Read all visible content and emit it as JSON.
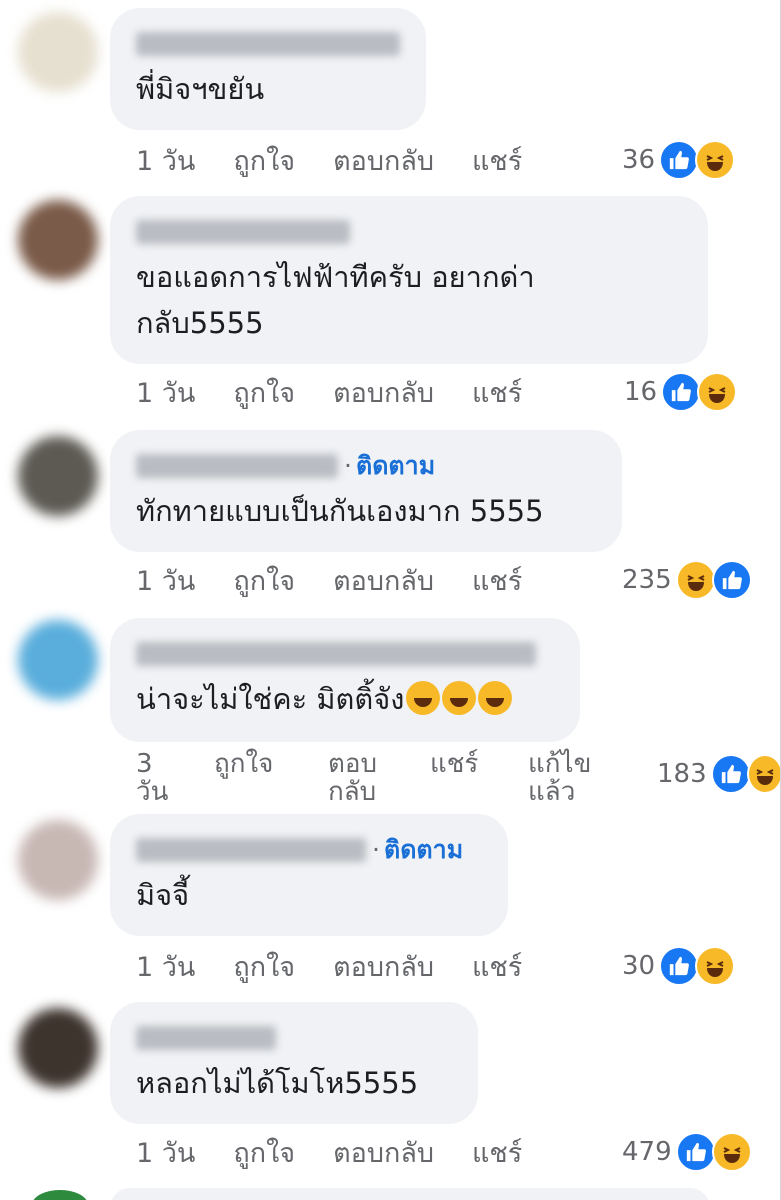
{
  "colors": {
    "bubble_bg": "#f0f2f5",
    "accent_blue": "#1a6fd6",
    "like_blue": "#1877f2",
    "haha_yellow": "#f7b928",
    "meta_gray": "#65676b"
  },
  "comments": [
    {
      "text": "พี่มิจฯขยัน",
      "follow": "",
      "time": "1 วัน",
      "like": "ถูกใจ",
      "reply": "ตอบกลับ",
      "share": "แชร์",
      "count": "36",
      "reaction_icons": [
        "like-icon",
        "haha-icon"
      ]
    },
    {
      "text": "ขอแอดการไฟฟ้าทีครับ อยากด่า",
      "text_line2": "กลับ5555",
      "follow": "",
      "time": "1 วัน",
      "like": "ถูกใจ",
      "reply": "ตอบกลับ",
      "share": "แชร์",
      "count": "16",
      "reaction_icons": [
        "like-icon",
        "haha-icon"
      ]
    },
    {
      "text": "ทักทายแบบเป็นกันเองมาก 5555",
      "follow": "ติดตาม",
      "time": "1 วัน",
      "like": "ถูกใจ",
      "reply": "ตอบกลับ",
      "share": "แชร์",
      "count": "235",
      "reaction_icons": [
        "haha-icon",
        "like-icon"
      ]
    },
    {
      "text": "น่าจะไม่ใช่คะ มิตติ้จัง",
      "follow": "",
      "time": "3 วัน",
      "like": "ถูกใจ",
      "reply": "ตอบกลับ",
      "share": "แชร์",
      "edited": "แก้ไขแล้ว",
      "count": "183",
      "reaction_icons": [
        "like-icon",
        "haha-icon"
      ]
    },
    {
      "text": "มิจจี้",
      "follow": "ติดตาม",
      "time": "1 วัน",
      "like": "ถูกใจ",
      "reply": "ตอบกลับ",
      "share": "แชร์",
      "count": "30",
      "reaction_icons": [
        "like-icon",
        "haha-icon"
      ]
    },
    {
      "text": "หลอกไม่ได้โมโห5555",
      "follow": "",
      "time": "1 วัน",
      "like": "ถูกใจ",
      "reply": "ตอบกลับ",
      "share": "แชร์",
      "count": "479",
      "reaction_icons": [
        "like-icon",
        "haha-icon"
      ]
    }
  ]
}
